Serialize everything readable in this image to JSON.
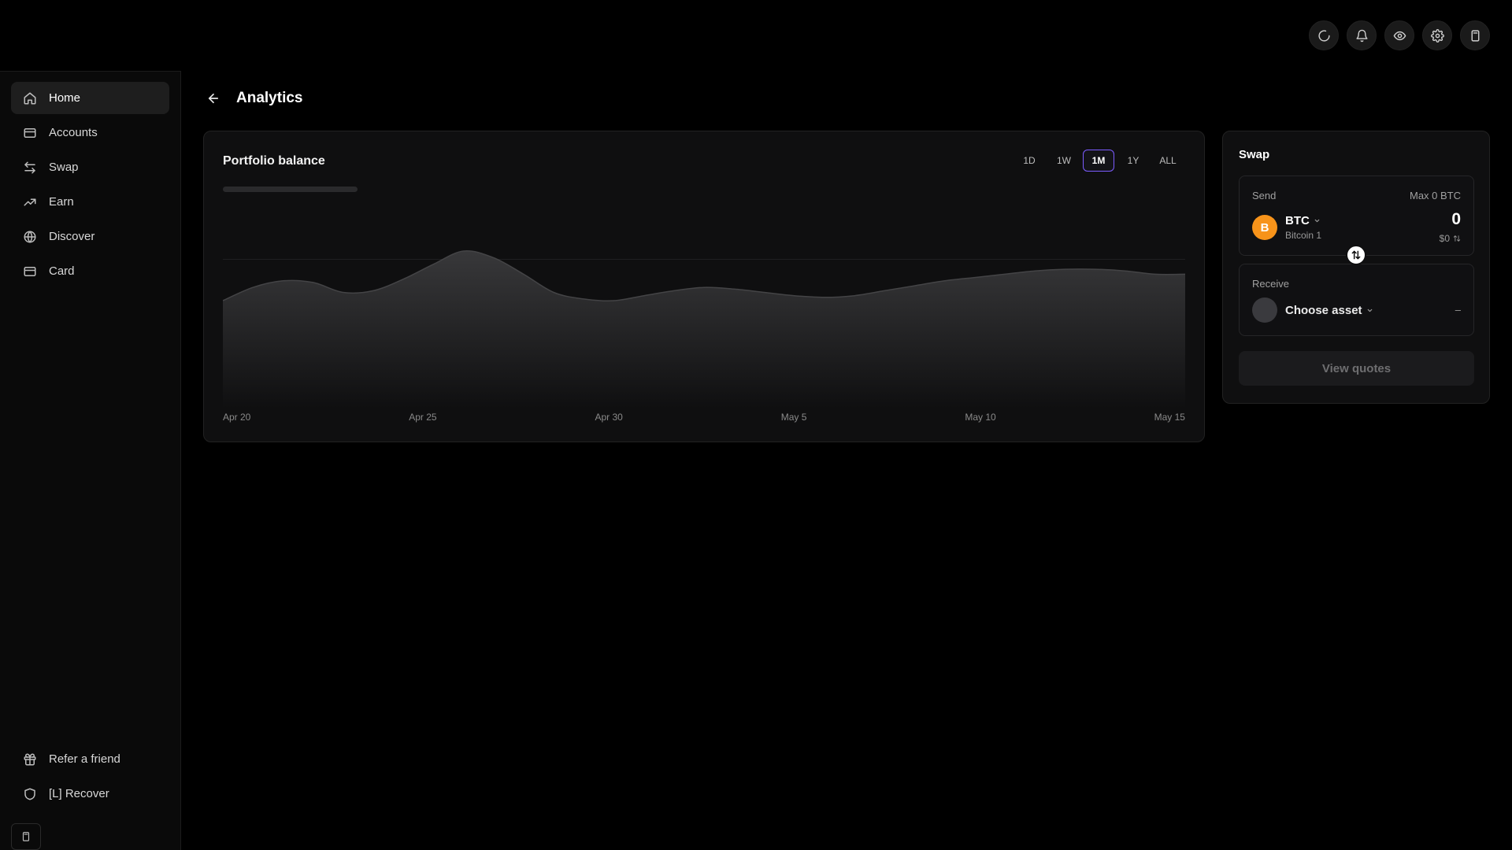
{
  "nav": {
    "items": [
      {
        "label": "Home",
        "icon": "home-icon",
        "active": true
      },
      {
        "label": "Accounts",
        "icon": "accounts-icon"
      },
      {
        "label": "Swap",
        "icon": "swap-icon"
      },
      {
        "label": "Earn",
        "icon": "trending-up-icon"
      },
      {
        "label": "Discover",
        "icon": "globe-icon"
      },
      {
        "label": "Card",
        "icon": "card-icon"
      }
    ],
    "bottom": [
      {
        "label": "Refer a friend",
        "icon": "gift-icon"
      },
      {
        "label": "[L] Recover",
        "icon": "shield-icon"
      }
    ]
  },
  "topbar": {
    "icons": [
      "loading-icon",
      "bell-icon",
      "eye-icon",
      "gear-icon",
      "clipboard-icon"
    ]
  },
  "header": {
    "title": "Analytics"
  },
  "portfolio": {
    "title": "Portfolio balance",
    "ranges": [
      "1D",
      "1W",
      "1M",
      "1Y",
      "ALL"
    ],
    "active_range": "1M"
  },
  "chart_data": {
    "type": "area",
    "x_tick_labels": [
      "Apr 20",
      "Apr 25",
      "Apr 30",
      "May 5",
      "May 10",
      "May 15"
    ],
    "values": [
      0.5,
      0.58,
      0.62,
      0.61,
      0.55,
      0.56,
      0.63,
      0.72,
      0.8,
      0.76,
      0.66,
      0.55,
      0.51,
      0.5,
      0.53,
      0.56,
      0.58,
      0.57,
      0.55,
      0.53,
      0.52,
      0.53,
      0.56,
      0.59,
      0.62,
      0.64,
      0.66,
      0.68,
      0.69,
      0.69,
      0.68,
      0.66,
      0.66
    ],
    "ylim": [
      0,
      1
    ],
    "grid": true,
    "colors": {
      "fill": "#3a3a3c",
      "line": "#444446"
    }
  },
  "swap": {
    "title": "Swap",
    "send": {
      "label": "Send",
      "max": "Max 0 BTC",
      "asset_symbol": "BTC",
      "asset_name": "Bitcoin 1",
      "asset_letter": "B",
      "amount": "0",
      "usd": "$0"
    },
    "receive": {
      "label": "Receive",
      "asset": "Choose asset",
      "value": "–"
    },
    "quotes_label": "View quotes"
  },
  "colors": {
    "accent": "#7c5cff",
    "btc": "#f7931a",
    "background": "#000000"
  }
}
